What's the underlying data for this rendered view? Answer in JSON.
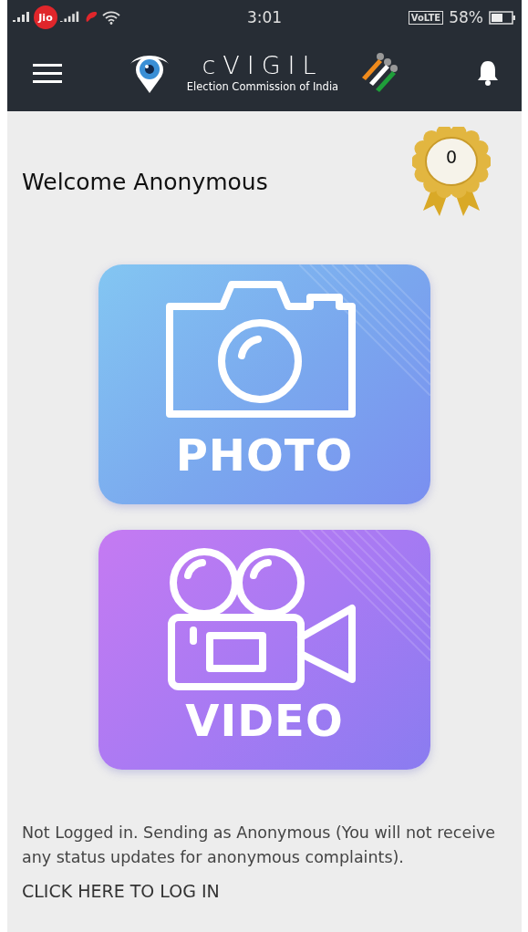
{
  "status_bar": {
    "carrier_badge": "Jio",
    "time": "3:01",
    "network_badge": "VoLTE",
    "battery": "58%"
  },
  "header": {
    "title": "cVIGIL",
    "subtitle": "Election Commission of India"
  },
  "welcome": "Welcome Anonymous",
  "badge_count": "0",
  "actions": [
    {
      "kind": "photo",
      "label": "PHOTO"
    },
    {
      "kind": "video",
      "label": "VIDEO"
    }
  ],
  "notice": "Not Logged in. Sending as Anonymous (You will not receive any status updates for anonymous complaints).",
  "login_link": "CLICK HERE TO LOG IN"
}
